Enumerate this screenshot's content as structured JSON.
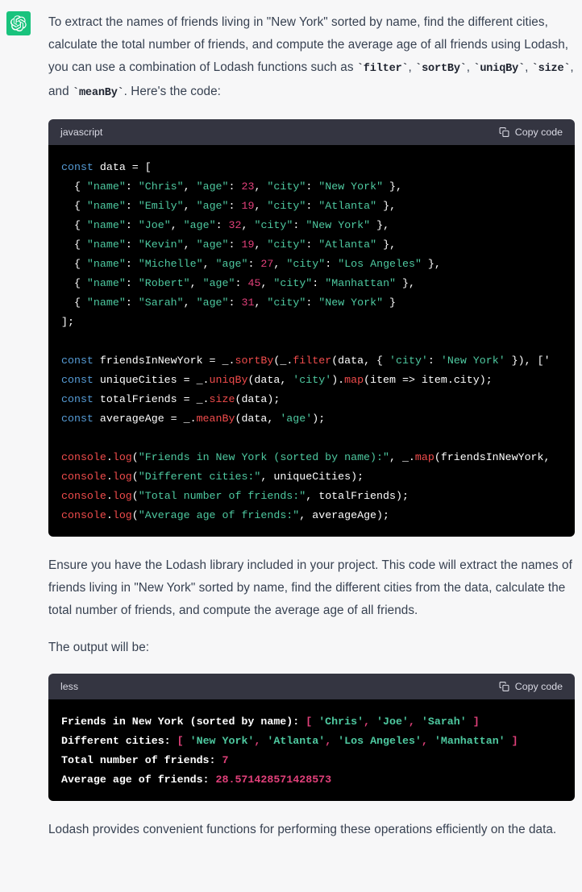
{
  "theme": {
    "page_background": "#f7f7f8",
    "text_color": "#374151",
    "avatar_background": "#19c37d",
    "code_header_background": "#343541",
    "code_body_background": "#000000",
    "keyword_color": "#569cd6",
    "function_color": "#f14c4c",
    "string_color": "#4ec9a0",
    "number_color": "#e1407a"
  },
  "avatar": {
    "icon": "openai-logo-icon"
  },
  "paragraphs": {
    "intro_1": "To extract the names of friends living in \"New York\" sorted by name, find the different cities, calculate the total number of friends, and compute the average age of all friends using Lodash, you can use a combination of Lodash functions such as ",
    "intro_code_1": "`filter`",
    "intro_sep_1": ", ",
    "intro_code_2": "`sortBy`",
    "intro_sep_2": ", ",
    "intro_code_3": "`uniqBy`",
    "intro_sep_3": ", ",
    "intro_code_4": "`size`",
    "intro_sep_4": ", and ",
    "intro_code_5": "`meanBy`",
    "intro_end": ". Here's the code:",
    "after_code": "Ensure you have the Lodash library included in your project. This code will extract the names of friends living in \"New York\" sorted by name, find the different cities from the data, calculate the total number of friends, and compute the average age of all friends.",
    "output_intro": "The output will be:",
    "closing": "Lodash provides convenient functions for performing these operations efficiently on the data."
  },
  "code_block_js": {
    "language": "javascript",
    "copy_label": "Copy code",
    "copy_icon": "clipboard-icon",
    "source_data": [
      {
        "name": "Chris",
        "age": 23,
        "city": "New York"
      },
      {
        "name": "Emily",
        "age": 19,
        "city": "Atlanta"
      },
      {
        "name": "Joe",
        "age": 32,
        "city": "New York"
      },
      {
        "name": "Kevin",
        "age": 19,
        "city": "Atlanta"
      },
      {
        "name": "Michelle",
        "age": 27,
        "city": "Los Angeles"
      },
      {
        "name": "Robert",
        "age": 45,
        "city": "Manhattan"
      },
      {
        "name": "Sarah",
        "age": 31,
        "city": "New York"
      }
    ],
    "lines": [
      [
        {
          "t": "const",
          "c": "kw"
        },
        {
          "t": " data = [",
          "c": "wht"
        }
      ],
      [
        {
          "t": "  { ",
          "c": "wht"
        },
        {
          "t": "\"name\"",
          "c": "str"
        },
        {
          "t": ": ",
          "c": "wht"
        },
        {
          "t": "\"Chris\"",
          "c": "str"
        },
        {
          "t": ", ",
          "c": "wht"
        },
        {
          "t": "\"age\"",
          "c": "str"
        },
        {
          "t": ": ",
          "c": "wht"
        },
        {
          "t": "23",
          "c": "num"
        },
        {
          "t": ", ",
          "c": "wht"
        },
        {
          "t": "\"city\"",
          "c": "str"
        },
        {
          "t": ": ",
          "c": "wht"
        },
        {
          "t": "\"New York\"",
          "c": "str"
        },
        {
          "t": " },",
          "c": "wht"
        }
      ],
      [
        {
          "t": "  { ",
          "c": "wht"
        },
        {
          "t": "\"name\"",
          "c": "str"
        },
        {
          "t": ": ",
          "c": "wht"
        },
        {
          "t": "\"Emily\"",
          "c": "str"
        },
        {
          "t": ", ",
          "c": "wht"
        },
        {
          "t": "\"age\"",
          "c": "str"
        },
        {
          "t": ": ",
          "c": "wht"
        },
        {
          "t": "19",
          "c": "num"
        },
        {
          "t": ", ",
          "c": "wht"
        },
        {
          "t": "\"city\"",
          "c": "str"
        },
        {
          "t": ": ",
          "c": "wht"
        },
        {
          "t": "\"Atlanta\"",
          "c": "str"
        },
        {
          "t": " },",
          "c": "wht"
        }
      ],
      [
        {
          "t": "  { ",
          "c": "wht"
        },
        {
          "t": "\"name\"",
          "c": "str"
        },
        {
          "t": ": ",
          "c": "wht"
        },
        {
          "t": "\"Joe\"",
          "c": "str"
        },
        {
          "t": ", ",
          "c": "wht"
        },
        {
          "t": "\"age\"",
          "c": "str"
        },
        {
          "t": ": ",
          "c": "wht"
        },
        {
          "t": "32",
          "c": "num"
        },
        {
          "t": ", ",
          "c": "wht"
        },
        {
          "t": "\"city\"",
          "c": "str"
        },
        {
          "t": ": ",
          "c": "wht"
        },
        {
          "t": "\"New York\"",
          "c": "str"
        },
        {
          "t": " },",
          "c": "wht"
        }
      ],
      [
        {
          "t": "  { ",
          "c": "wht"
        },
        {
          "t": "\"name\"",
          "c": "str"
        },
        {
          "t": ": ",
          "c": "wht"
        },
        {
          "t": "\"Kevin\"",
          "c": "str"
        },
        {
          "t": ", ",
          "c": "wht"
        },
        {
          "t": "\"age\"",
          "c": "str"
        },
        {
          "t": ": ",
          "c": "wht"
        },
        {
          "t": "19",
          "c": "num"
        },
        {
          "t": ", ",
          "c": "wht"
        },
        {
          "t": "\"city\"",
          "c": "str"
        },
        {
          "t": ": ",
          "c": "wht"
        },
        {
          "t": "\"Atlanta\"",
          "c": "str"
        },
        {
          "t": " },",
          "c": "wht"
        }
      ],
      [
        {
          "t": "  { ",
          "c": "wht"
        },
        {
          "t": "\"name\"",
          "c": "str"
        },
        {
          "t": ": ",
          "c": "wht"
        },
        {
          "t": "\"Michelle\"",
          "c": "str"
        },
        {
          "t": ", ",
          "c": "wht"
        },
        {
          "t": "\"age\"",
          "c": "str"
        },
        {
          "t": ": ",
          "c": "wht"
        },
        {
          "t": "27",
          "c": "num"
        },
        {
          "t": ", ",
          "c": "wht"
        },
        {
          "t": "\"city\"",
          "c": "str"
        },
        {
          "t": ": ",
          "c": "wht"
        },
        {
          "t": "\"Los Angeles\"",
          "c": "str"
        },
        {
          "t": " },",
          "c": "wht"
        }
      ],
      [
        {
          "t": "  { ",
          "c": "wht"
        },
        {
          "t": "\"name\"",
          "c": "str"
        },
        {
          "t": ": ",
          "c": "wht"
        },
        {
          "t": "\"Robert\"",
          "c": "str"
        },
        {
          "t": ", ",
          "c": "wht"
        },
        {
          "t": "\"age\"",
          "c": "str"
        },
        {
          "t": ": ",
          "c": "wht"
        },
        {
          "t": "45",
          "c": "num"
        },
        {
          "t": ", ",
          "c": "wht"
        },
        {
          "t": "\"city\"",
          "c": "str"
        },
        {
          "t": ": ",
          "c": "wht"
        },
        {
          "t": "\"Manhattan\"",
          "c": "str"
        },
        {
          "t": " },",
          "c": "wht"
        }
      ],
      [
        {
          "t": "  { ",
          "c": "wht"
        },
        {
          "t": "\"name\"",
          "c": "str"
        },
        {
          "t": ": ",
          "c": "wht"
        },
        {
          "t": "\"Sarah\"",
          "c": "str"
        },
        {
          "t": ", ",
          "c": "wht"
        },
        {
          "t": "\"age\"",
          "c": "str"
        },
        {
          "t": ": ",
          "c": "wht"
        },
        {
          "t": "31",
          "c": "num"
        },
        {
          "t": ", ",
          "c": "wht"
        },
        {
          "t": "\"city\"",
          "c": "str"
        },
        {
          "t": ": ",
          "c": "wht"
        },
        {
          "t": "\"New York\"",
          "c": "str"
        },
        {
          "t": " }",
          "c": "wht"
        }
      ],
      [
        {
          "t": "];",
          "c": "wht"
        }
      ],
      [
        {
          "t": "",
          "c": "wht"
        }
      ],
      [
        {
          "t": "const",
          "c": "kw"
        },
        {
          "t": " friendsInNewYork = _.",
          "c": "wht"
        },
        {
          "t": "sortBy",
          "c": "fn"
        },
        {
          "t": "(_.",
          "c": "wht"
        },
        {
          "t": "filter",
          "c": "fn"
        },
        {
          "t": "(data, { ",
          "c": "wht"
        },
        {
          "t": "'city'",
          "c": "str"
        },
        {
          "t": ": ",
          "c": "wht"
        },
        {
          "t": "'New York'",
          "c": "str"
        },
        {
          "t": " }), ['",
          "c": "wht"
        }
      ],
      [
        {
          "t": "const",
          "c": "kw"
        },
        {
          "t": " uniqueCities = _.",
          "c": "wht"
        },
        {
          "t": "uniqBy",
          "c": "fn"
        },
        {
          "t": "(data, ",
          "c": "wht"
        },
        {
          "t": "'city'",
          "c": "str"
        },
        {
          "t": ").",
          "c": "wht"
        },
        {
          "t": "map",
          "c": "fn"
        },
        {
          "t": "(item => item.city);",
          "c": "wht"
        }
      ],
      [
        {
          "t": "const",
          "c": "kw"
        },
        {
          "t": " totalFriends = _.",
          "c": "wht"
        },
        {
          "t": "size",
          "c": "fn"
        },
        {
          "t": "(data);",
          "c": "wht"
        }
      ],
      [
        {
          "t": "const",
          "c": "kw"
        },
        {
          "t": " averageAge = _.",
          "c": "wht"
        },
        {
          "t": "meanBy",
          "c": "fn"
        },
        {
          "t": "(data, ",
          "c": "wht"
        },
        {
          "t": "'age'",
          "c": "str"
        },
        {
          "t": ");",
          "c": "wht"
        }
      ],
      [
        {
          "t": "",
          "c": "wht"
        }
      ],
      [
        {
          "t": "console",
          "c": "fn"
        },
        {
          "t": ".",
          "c": "wht"
        },
        {
          "t": "log",
          "c": "fn"
        },
        {
          "t": "(",
          "c": "wht"
        },
        {
          "t": "\"Friends in New York (sorted by name):\"",
          "c": "str"
        },
        {
          "t": ", _.",
          "c": "wht"
        },
        {
          "t": "map",
          "c": "fn"
        },
        {
          "t": "(friendsInNewYork,",
          "c": "wht"
        }
      ],
      [
        {
          "t": "console",
          "c": "fn"
        },
        {
          "t": ".",
          "c": "wht"
        },
        {
          "t": "log",
          "c": "fn"
        },
        {
          "t": "(",
          "c": "wht"
        },
        {
          "t": "\"Different cities:\"",
          "c": "str"
        },
        {
          "t": ", uniqueCities);",
          "c": "wht"
        }
      ],
      [
        {
          "t": "console",
          "c": "fn"
        },
        {
          "t": ".",
          "c": "wht"
        },
        {
          "t": "log",
          "c": "fn"
        },
        {
          "t": "(",
          "c": "wht"
        },
        {
          "t": "\"Total number of friends:\"",
          "c": "str"
        },
        {
          "t": ", totalFriends);",
          "c": "wht"
        }
      ],
      [
        {
          "t": "console",
          "c": "fn"
        },
        {
          "t": ".",
          "c": "wht"
        },
        {
          "t": "log",
          "c": "fn"
        },
        {
          "t": "(",
          "c": "wht"
        },
        {
          "t": "\"Average age of friends:\"",
          "c": "str"
        },
        {
          "t": ", averageAge);",
          "c": "wht"
        }
      ]
    ]
  },
  "code_block_output": {
    "language": "less",
    "copy_label": "Copy code",
    "copy_icon": "clipboard-icon",
    "results": {
      "friends_in_new_york": [
        "Chris",
        "Joe",
        "Sarah"
      ],
      "different_cities": [
        "New York",
        "Atlanta",
        "Los Angeles",
        "Manhattan"
      ],
      "total_number_of_friends": 7,
      "average_age_of_friends": "28.571428571428573"
    },
    "lines": [
      [
        {
          "t": "Friends in New York (sorted by name): ",
          "c": "wht"
        },
        {
          "t": "[",
          "c": "pnk"
        },
        {
          "t": " ",
          "c": "wht"
        },
        {
          "t": "'Chris'",
          "c": "str"
        },
        {
          "t": ",",
          "c": "pnk"
        },
        {
          "t": " ",
          "c": "wht"
        },
        {
          "t": "'Joe'",
          "c": "str"
        },
        {
          "t": ",",
          "c": "pnk"
        },
        {
          "t": " ",
          "c": "wht"
        },
        {
          "t": "'Sarah'",
          "c": "str"
        },
        {
          "t": " ",
          "c": "wht"
        },
        {
          "t": "]",
          "c": "pnk"
        }
      ],
      [
        {
          "t": "Different cities: ",
          "c": "wht"
        },
        {
          "t": "[",
          "c": "pnk"
        },
        {
          "t": " ",
          "c": "wht"
        },
        {
          "t": "'New York'",
          "c": "str"
        },
        {
          "t": ",",
          "c": "pnk"
        },
        {
          "t": " ",
          "c": "wht"
        },
        {
          "t": "'Atlanta'",
          "c": "str"
        },
        {
          "t": ",",
          "c": "pnk"
        },
        {
          "t": " ",
          "c": "wht"
        },
        {
          "t": "'Los Angeles'",
          "c": "str"
        },
        {
          "t": ",",
          "c": "pnk"
        },
        {
          "t": " ",
          "c": "wht"
        },
        {
          "t": "'Manhattan'",
          "c": "str"
        },
        {
          "t": " ",
          "c": "wht"
        },
        {
          "t": "]",
          "c": "pnk"
        }
      ],
      [
        {
          "t": "Total number of friends: ",
          "c": "wht"
        },
        {
          "t": "7",
          "c": "num"
        }
      ],
      [
        {
          "t": "Average age of friends: ",
          "c": "wht"
        },
        {
          "t": "28.571428571428573",
          "c": "num"
        }
      ]
    ]
  }
}
